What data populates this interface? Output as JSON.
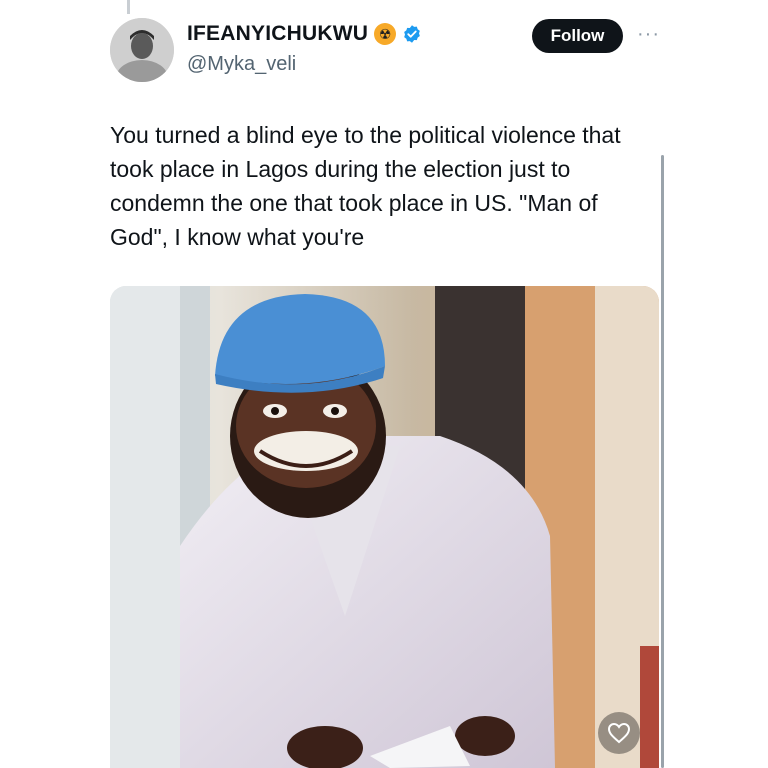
{
  "author": {
    "display_name": "IFEANYICHUKWU",
    "handle": "@Myka_veli",
    "badge_emoji": "☢",
    "verified": true
  },
  "actions": {
    "follow_label": "Follow",
    "more_label": "···"
  },
  "tweet": {
    "text": "You turned a blind eye to the political violence that took place in Lagos during the election just to condemn the one that took place in US. \"Man of God\", I know what you're"
  },
  "colors": {
    "verified": "#1d9bf0",
    "follow_bg": "#0f1419",
    "badge": "#f7a928"
  },
  "icons": [
    "radioactive-emoji-icon",
    "verified-badge-icon",
    "more-options-icon",
    "heart-icon"
  ]
}
